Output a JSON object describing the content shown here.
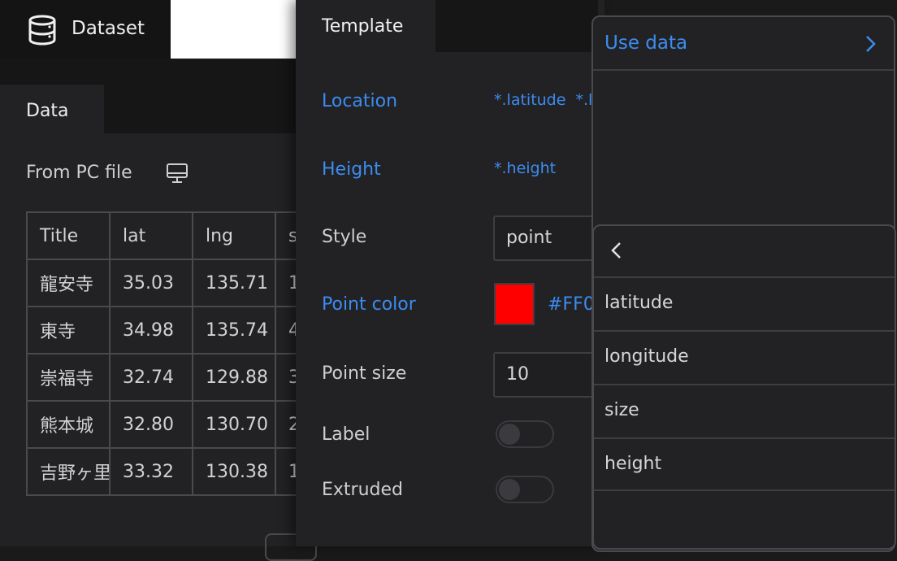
{
  "dataset": {
    "title": "Dataset",
    "data_tab": "Data",
    "source_label": "From PC file",
    "table": {
      "headers": [
        "Title",
        "lat",
        "lng",
        "s"
      ],
      "rows": [
        [
          "龍安寺",
          "35.03",
          "135.71",
          "1"
        ],
        [
          "東寺",
          "34.98",
          "135.74",
          "4"
        ],
        [
          "崇福寺",
          "32.74",
          "129.88",
          "3"
        ],
        [
          "熊本城",
          "32.80",
          "130.70",
          "2"
        ],
        [
          "吉野ヶ里",
          "33.32",
          "130.38",
          "1"
        ]
      ]
    }
  },
  "template": {
    "tab": "Template",
    "location": {
      "label": "Location",
      "value": "*.latitude  *.l"
    },
    "height": {
      "label": "Height",
      "value": "*.height"
    },
    "style": {
      "label": "Style",
      "value": "point"
    },
    "point_color": {
      "label": "Point color",
      "value": "#FF0",
      "swatch_color": "#ff0000"
    },
    "point_size": {
      "label": "Point size",
      "value": "10"
    },
    "label_toggle": {
      "label": "Label",
      "on": false
    },
    "extruded_toggle": {
      "label": "Extruded",
      "on": false
    }
  },
  "menu": {
    "use_data": "Use data",
    "fields": [
      "latitude",
      "longitude",
      "size",
      "height"
    ]
  },
  "colors": {
    "accent": "#3c8cf0",
    "panel": "#222225",
    "header": "#141414"
  }
}
